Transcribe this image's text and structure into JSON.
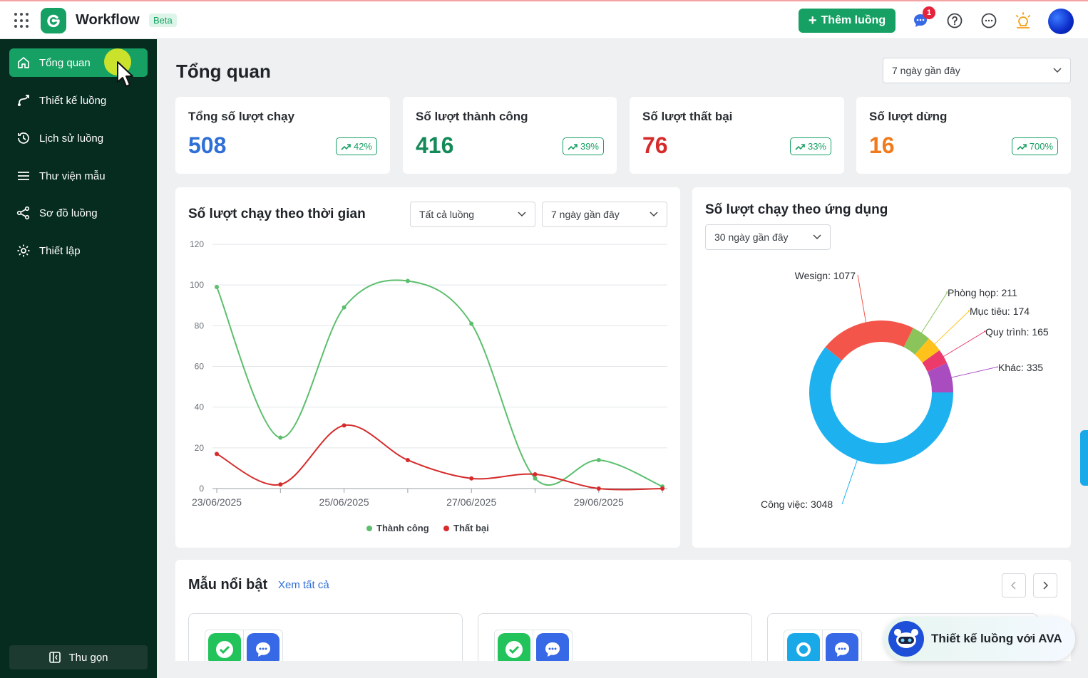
{
  "app": {
    "title": "Workflow",
    "badge": "Beta"
  },
  "header": {
    "add_flow_label": "Thêm luồng",
    "notification_count": "1"
  },
  "sidebar": {
    "items": [
      {
        "label": "Tổng quan",
        "icon": "home-icon",
        "active": true
      },
      {
        "label": "Thiết kế luồng",
        "icon": "flow-design-icon"
      },
      {
        "label": "Lịch sử luồng",
        "icon": "history-icon"
      },
      {
        "label": "Thư viện mẫu",
        "icon": "menu-icon"
      },
      {
        "label": "Sơ đồ luồng",
        "icon": "share-graph-icon"
      },
      {
        "label": "Thiết lập",
        "icon": "gear-icon"
      }
    ],
    "collapse_label": "Thu gọn"
  },
  "page": {
    "title": "Tổng quan",
    "range_select": "7 ngày gần đây"
  },
  "stats": [
    {
      "label": "Tổng số lượt chạy",
      "value": "508",
      "change": "42%",
      "color": "#2f6fd6"
    },
    {
      "label": "Số lượt thành công",
      "value": "416",
      "change": "39%",
      "color": "#138a57"
    },
    {
      "label": "Số lượt thất bại",
      "value": "76",
      "change": "33%",
      "color": "#d62b2b"
    },
    {
      "label": "Số lượt dừng",
      "value": "16",
      "change": "700%",
      "color": "#f07a1c"
    }
  ],
  "time_chart": {
    "title": "Số lượt chạy theo thời gian",
    "flow_select": "Tất cả luồng",
    "range_select": "7 ngày gần đây"
  },
  "app_chart": {
    "title": "Số lượt chạy theo ứng dụng",
    "range_select": "30 ngày gần đây"
  },
  "templates": {
    "title": "Mẫu nổi bật",
    "see_all": "Xem tất cả",
    "cards": [
      {
        "icons": [
          "check-app-icon",
          "chat-app-icon"
        ]
      },
      {
        "icons": [
          "check-app-icon",
          "chat-app-icon"
        ]
      },
      {
        "icons": [
          "search-app-icon",
          "chat-app-icon"
        ]
      }
    ]
  },
  "ava": {
    "label": "Thiết kế luồng với AVA"
  },
  "chart_data": [
    {
      "type": "line",
      "x": [
        "23/06/2025",
        "24/06/2025",
        "25/06/2025",
        "26/06/2025",
        "27/06/2025",
        "28/06/2025",
        "29/06/2025",
        "30/06/2025"
      ],
      "x_tick_labels": [
        "23/06/2025",
        "",
        "25/06/2025",
        "",
        "27/06/2025",
        "",
        "29/06/2025",
        ""
      ],
      "series": [
        {
          "name": "Thành công",
          "color": "#5cbf6e",
          "values": [
            99,
            25,
            89,
            102,
            81,
            5,
            14,
            1
          ]
        },
        {
          "name": "Thất bại",
          "color": "#d62b2b",
          "values": [
            17,
            2,
            31,
            14,
            5,
            7,
            0,
            0
          ]
        }
      ],
      "ylim": [
        0,
        120
      ],
      "yticks": [
        0,
        20,
        40,
        60,
        80,
        100,
        120
      ],
      "grid": true,
      "legend": "bottom"
    },
    {
      "type": "pie",
      "donut": true,
      "slices": [
        {
          "label": "Công việc",
          "value": 3048,
          "color": "#1eb1f0"
        },
        {
          "label": "Wesign",
          "value": 1077,
          "color": "#f4554a"
        },
        {
          "label": "Phòng họp",
          "value": 211,
          "color": "#8ac45a"
        },
        {
          "label": "Mục tiêu",
          "value": 174,
          "color": "#ffc21a"
        },
        {
          "label": "Quy trình",
          "value": 165,
          "color": "#ec3b6a"
        },
        {
          "label": "Khác",
          "value": 335,
          "color": "#a94cc0"
        }
      ]
    }
  ]
}
